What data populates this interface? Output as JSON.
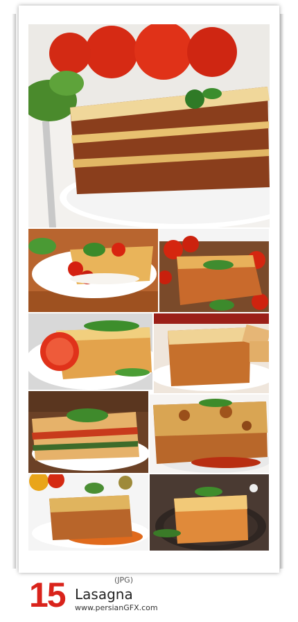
{
  "footer": {
    "count": "15",
    "format": "(JPG)",
    "title": "Lasagna",
    "site": "www.persianGFX.com"
  },
  "photos": [
    {
      "name": "lasagna-with-tomatoes-hero"
    },
    {
      "name": "lasagna-with-cherry-tomatoes-plate"
    },
    {
      "name": "lasagna-slice-with-basil"
    },
    {
      "name": "lasagna-with-tomato-slices"
    },
    {
      "name": "lasagna-on-white-plate"
    },
    {
      "name": "lasagna-with-spinach"
    },
    {
      "name": "baked-cheesy-lasagna"
    },
    {
      "name": "lasagna-with-sauce"
    },
    {
      "name": "lasagna-on-dark-plate"
    }
  ]
}
